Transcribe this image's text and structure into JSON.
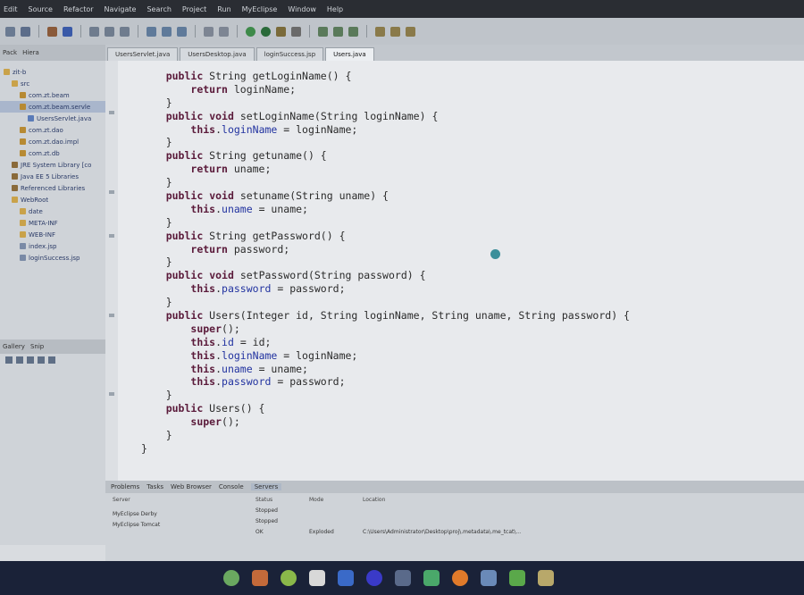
{
  "menubar": [
    "Edit",
    "Source",
    "Refactor",
    "Navigate",
    "Search",
    "Project",
    "Run",
    "MyEclipse",
    "Window",
    "Help"
  ],
  "left_panel": {
    "tabs": [
      "Pack",
      "Hiera"
    ],
    "tree": [
      {
        "label": "zit-b",
        "icon": "project-icon",
        "indent": 0
      },
      {
        "label": "src",
        "icon": "folder-icon",
        "indent": 1
      },
      {
        "label": "com.zt.beam",
        "icon": "package-icon",
        "indent": 2
      },
      {
        "label": "com.zt.beam.servle",
        "icon": "package-icon",
        "indent": 2,
        "selected": true
      },
      {
        "label": "UsersServlet.java",
        "icon": "java-file-icon",
        "indent": 3
      },
      {
        "label": "com.zt.dao",
        "icon": "package-icon",
        "indent": 2
      },
      {
        "label": "com.zt.dao.impl",
        "icon": "package-icon",
        "indent": 2
      },
      {
        "label": "com.zt.db",
        "icon": "package-icon",
        "indent": 2
      },
      {
        "label": "JRE System Library [co",
        "icon": "library-icon",
        "indent": 1
      },
      {
        "label": "Java EE 5 Libraries",
        "icon": "library-icon",
        "indent": 1
      },
      {
        "label": "Referenced Libraries",
        "icon": "library-icon",
        "indent": 1
      },
      {
        "label": "WebRoot",
        "icon": "folder-icon",
        "indent": 1
      },
      {
        "label": "date",
        "icon": "folder-icon",
        "indent": 2
      },
      {
        "label": "META-INF",
        "icon": "folder-icon",
        "indent": 2
      },
      {
        "label": "WEB-INF",
        "icon": "folder-icon",
        "indent": 2
      },
      {
        "label": "index.jsp",
        "icon": "jsp-file-icon",
        "indent": 2
      },
      {
        "label": "loginSuccess.jsp",
        "icon": "jsp-file-icon",
        "indent": 2
      }
    ],
    "lower_tabs": [
      "Gallery",
      "Snip"
    ]
  },
  "editor": {
    "tabs": [
      {
        "label": "UsersServlet.java",
        "active": false
      },
      {
        "label": "UsersDesktop.java",
        "active": false
      },
      {
        "label": "loginSuccess.jsp",
        "active": false
      },
      {
        "label": "Users.java",
        "active": true
      }
    ],
    "lines": [
      "    public String getLoginName() {",
      "        return loginName;",
      "    }",
      "    public void setLoginName(String loginName) {",
      "        this.loginName = loginName;",
      "    }",
      "    public String getuname() {",
      "        return uname;",
      "    }",
      "    public void setuname(String uname) {",
      "        this.uname = uname;",
      "    }",
      "    public String getPassword() {",
      "        return password;",
      "    }",
      "    public void setPassword(String password) {",
      "        this.password = password;",
      "    }",
      "    public Users(Integer id, String loginName, String uname, String password) {",
      "        super();",
      "        this.id = id;",
      "        this.loginName = loginName;",
      "        this.uname = uname;",
      "        this.password = password;",
      "    }",
      "    public Users() {",
      "        super();",
      "    }",
      "}"
    ]
  },
  "bottom_panel": {
    "tabs": [
      "Problems",
      "Tasks",
      "Web Browser",
      "Console",
      "Servers"
    ],
    "active_tab": "Servers",
    "columns": [
      "Server",
      "Status",
      "Mode",
      "Location"
    ],
    "rows": [
      {
        "server": "MyEclipse Derby",
        "status": "Stopped",
        "mode": "",
        "location": ""
      },
      {
        "server": "MyEclipse Tomcat",
        "status": "Stopped",
        "mode": "",
        "location": ""
      },
      {
        "server": "",
        "status": "OK",
        "mode": "Exploded",
        "location": "C:\\Users\\Administrator\\Desktop\\proj\\.metadata\\.me_tcat\\..."
      }
    ]
  }
}
